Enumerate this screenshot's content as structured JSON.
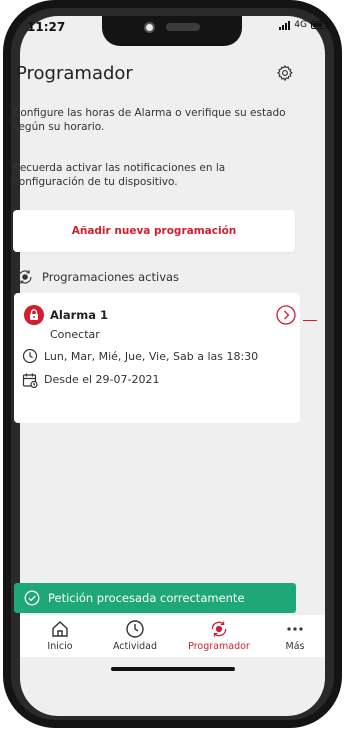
{
  "status": {
    "time": "11:27",
    "network": "4G"
  },
  "header": {
    "title": "Programador"
  },
  "description": {
    "line1": "Configure las horas de Alarma o verifique su estado según su horario.",
    "line2": "Recuerda activar las notificaciones en la configuración de tu dispositivo."
  },
  "add_button": {
    "label": "Añadir nueva programación"
  },
  "section": {
    "title": "Programaciones activas"
  },
  "schedule": {
    "name": "Alarma 1",
    "action": "Conectar",
    "days": "Lun, Mar, Mié, Jue, Vie, Sab  a las 18:30",
    "since": "Desde el 29-07-2021"
  },
  "toast": {
    "message": "Petición procesada correctamente"
  },
  "tabs": [
    {
      "label": "Inicio",
      "icon": "home-icon"
    },
    {
      "label": "Actividad",
      "icon": "clock-icon"
    },
    {
      "label": "Programador",
      "icon": "scheduler-icon"
    },
    {
      "label": "Más",
      "icon": "more-icon"
    }
  ],
  "colors": {
    "accent": "#d01f2f",
    "success": "#1ea878",
    "background": "#efefef"
  }
}
